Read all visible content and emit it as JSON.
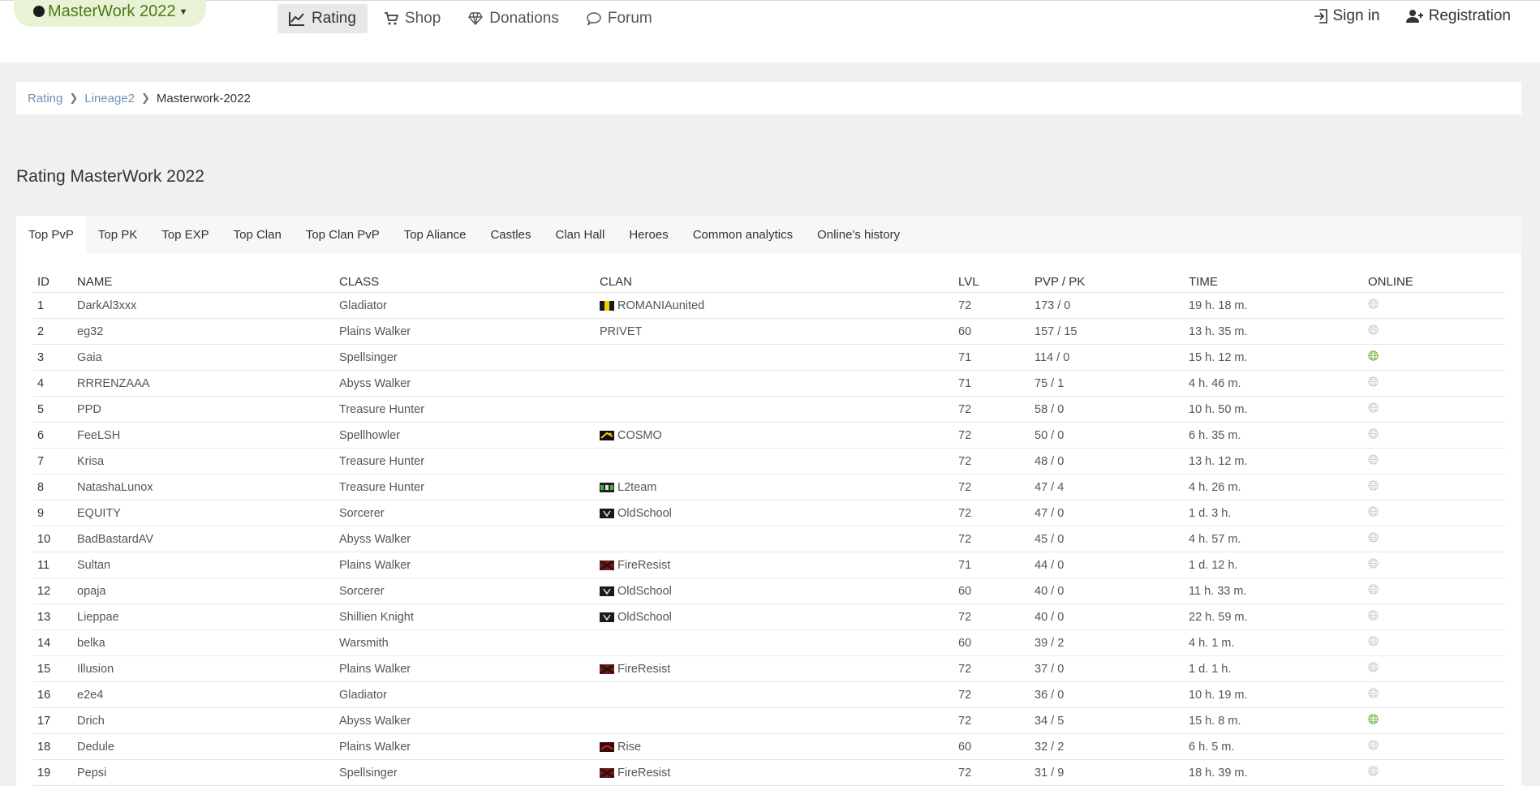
{
  "brand": {
    "name": "MasterWork 2022"
  },
  "nav": [
    {
      "label": "Rating",
      "icon": "chart-line-icon",
      "active": true
    },
    {
      "label": "Shop",
      "icon": "cart-icon",
      "active": false
    },
    {
      "label": "Donations",
      "icon": "diamond-icon",
      "active": false
    },
    {
      "label": "Forum",
      "icon": "chat-icon",
      "active": false
    }
  ],
  "auth": {
    "signin": "Sign in",
    "registration": "Registration"
  },
  "breadcrumb": [
    "Rating",
    "Lineage2",
    "Masterwork-2022"
  ],
  "page_title": "Rating MasterWork 2022",
  "tabs": [
    "Top PvP",
    "Top PK",
    "Top EXP",
    "Top Clan",
    "Top Clan PvP",
    "Top Aliance",
    "Castles",
    "Clan Hall",
    "Heroes",
    "Common analytics",
    "Online's history"
  ],
  "table": {
    "headers": [
      "ID",
      "NAME",
      "CLASS",
      "CLAN",
      "LVL",
      "PVP / PK",
      "TIME",
      "ONLINE"
    ],
    "rows": [
      {
        "id": "1",
        "name": "DarkAl3xxx",
        "class": "Gladiator",
        "clan": "ROMANIAunited",
        "flag": "romania",
        "lvl": "72",
        "pvppk": "173 / 0",
        "time": "19 h. 18 m.",
        "online": false
      },
      {
        "id": "2",
        "name": "eg32",
        "class": "Plains Walker",
        "clan": "PRIVET",
        "flag": "",
        "lvl": "60",
        "pvppk": "157 / 15",
        "time": "13 h. 35 m.",
        "online": false
      },
      {
        "id": "3",
        "name": "Gaia",
        "class": "Spellsinger",
        "clan": "",
        "flag": "",
        "lvl": "71",
        "pvppk": "114 / 0",
        "time": "15 h. 12 m.",
        "online": true
      },
      {
        "id": "4",
        "name": "RRRENZAAA",
        "class": "Abyss Walker",
        "clan": "",
        "flag": "",
        "lvl": "71",
        "pvppk": "75 / 1",
        "time": "4 h. 46 m.",
        "online": false
      },
      {
        "id": "5",
        "name": "PPD",
        "class": "Treasure Hunter",
        "clan": "",
        "flag": "",
        "lvl": "72",
        "pvppk": "58 / 0",
        "time": "10 h. 50 m.",
        "online": false
      },
      {
        "id": "6",
        "name": "FeeLSH",
        "class": "Spellhowler",
        "clan": "COSMO",
        "flag": "cosmo",
        "lvl": "72",
        "pvppk": "50 / 0",
        "time": "6 h. 35 m.",
        "online": false
      },
      {
        "id": "7",
        "name": "Krisa",
        "class": "Treasure Hunter",
        "clan": "",
        "flag": "",
        "lvl": "72",
        "pvppk": "48 / 0",
        "time": "13 h. 12 m.",
        "online": false
      },
      {
        "id": "8",
        "name": "NatashaLunox",
        "class": "Treasure Hunter",
        "clan": "L2team",
        "flag": "l2team",
        "lvl": "72",
        "pvppk": "47 / 4",
        "time": "4 h. 26 m.",
        "online": false
      },
      {
        "id": "9",
        "name": "EQUITY",
        "class": "Sorcerer",
        "clan": "OldSchool",
        "flag": "oldschool",
        "lvl": "72",
        "pvppk": "47 / 0",
        "time": "1 d. 3 h.",
        "online": false
      },
      {
        "id": "10",
        "name": "BadBastardAV",
        "class": "Abyss Walker",
        "clan": "",
        "flag": "",
        "lvl": "72",
        "pvppk": "45 / 0",
        "time": "4 h. 57 m.",
        "online": false
      },
      {
        "id": "11",
        "name": "Sultan",
        "class": "Plains Walker",
        "clan": "FireResist",
        "flag": "fireresist",
        "lvl": "71",
        "pvppk": "44 / 0",
        "time": "1 d. 12 h.",
        "online": false
      },
      {
        "id": "12",
        "name": "opaja",
        "class": "Sorcerer",
        "clan": "OldSchool",
        "flag": "oldschool",
        "lvl": "60",
        "pvppk": "40 / 0",
        "time": "11 h. 33 m.",
        "online": false
      },
      {
        "id": "13",
        "name": "Lieppae",
        "class": "Shillien Knight",
        "clan": "OldSchool",
        "flag": "oldschool",
        "lvl": "72",
        "pvppk": "40 / 0",
        "time": "22 h. 59 m.",
        "online": false
      },
      {
        "id": "14",
        "name": "belka",
        "class": "Warsmith",
        "clan": "",
        "flag": "",
        "lvl": "60",
        "pvppk": "39 / 2",
        "time": "4 h. 1 m.",
        "online": false
      },
      {
        "id": "15",
        "name": "Illusion",
        "class": "Plains Walker",
        "clan": "FireResist",
        "flag": "fireresist",
        "lvl": "72",
        "pvppk": "37 / 0",
        "time": "1 d. 1 h.",
        "online": false
      },
      {
        "id": "16",
        "name": "e2e4",
        "class": "Gladiator",
        "clan": "",
        "flag": "",
        "lvl": "72",
        "pvppk": "36 / 0",
        "time": "10 h. 19 m.",
        "online": false
      },
      {
        "id": "17",
        "name": "Drich",
        "class": "Abyss Walker",
        "clan": "",
        "flag": "",
        "lvl": "72",
        "pvppk": "34 / 5",
        "time": "15 h. 8 m.",
        "online": true
      },
      {
        "id": "18",
        "name": "Dedule",
        "class": "Plains Walker",
        "clan": "Rise",
        "flag": "rise",
        "lvl": "60",
        "pvppk": "32 / 2",
        "time": "6 h. 5 m.",
        "online": false
      },
      {
        "id": "19",
        "name": "Pepsi",
        "class": "Spellsinger",
        "clan": "FireResist",
        "flag": "fireresist",
        "lvl": "72",
        "pvppk": "31 / 9",
        "time": "18 h. 39 m.",
        "online": false
      }
    ]
  },
  "colors": {
    "online": "#7ab648",
    "offline": "#cfcfcf",
    "link": "#6e93b8",
    "brand_bg": "#e8f3d6"
  }
}
